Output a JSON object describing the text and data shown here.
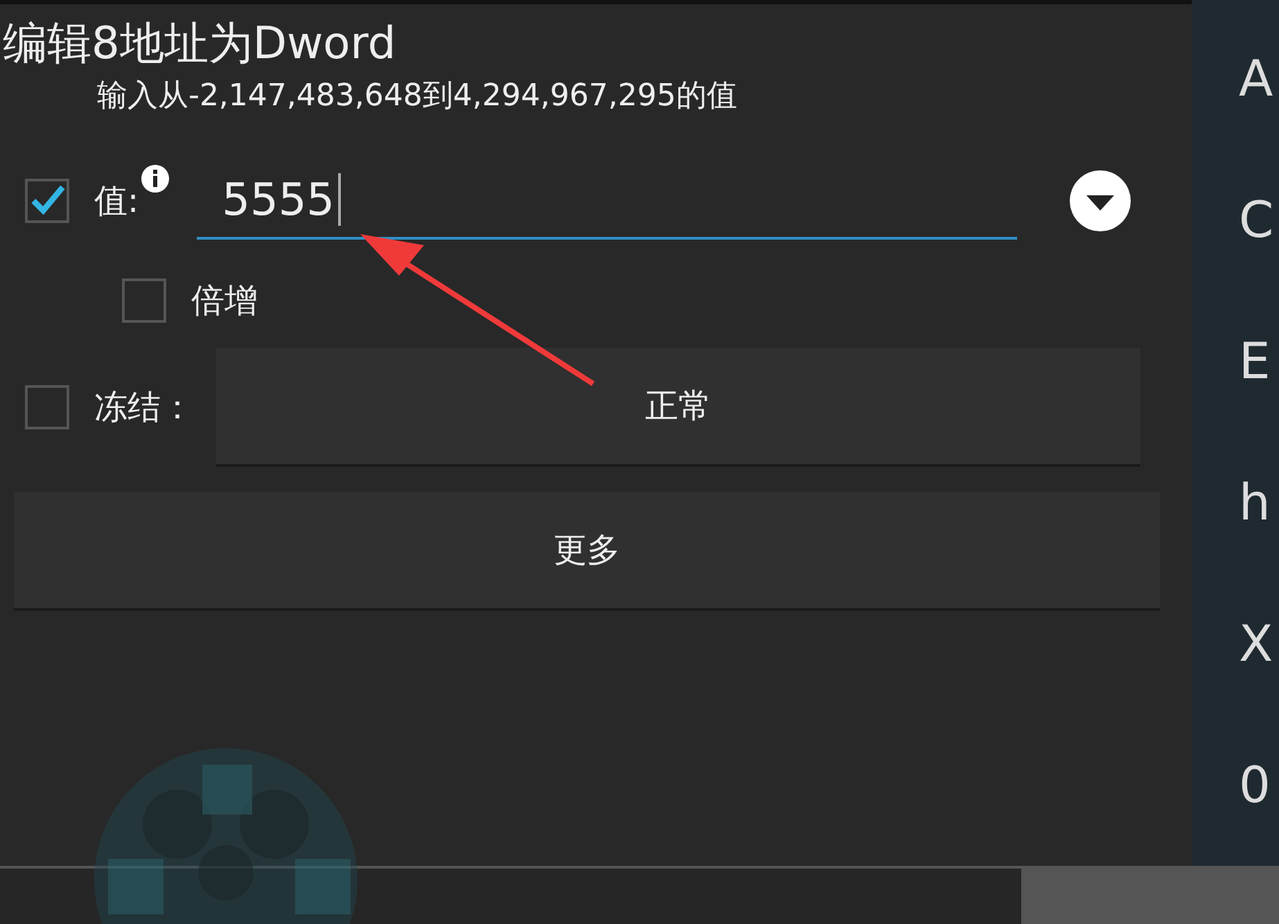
{
  "dialog": {
    "title": "编辑8地址为Dword",
    "hint": "输入从-2,147,483,648到4,294,967,295的值",
    "value_row": {
      "checked": true,
      "label": "值:",
      "value": "5555"
    },
    "multiply": {
      "checked": false,
      "label": "倍增"
    },
    "freeze": {
      "checked": false,
      "label": "冻结：",
      "mode_button": "正常"
    },
    "more_button": "更多"
  },
  "side_list": [
    "A",
    "C",
    "E",
    "h",
    "X",
    "0"
  ]
}
